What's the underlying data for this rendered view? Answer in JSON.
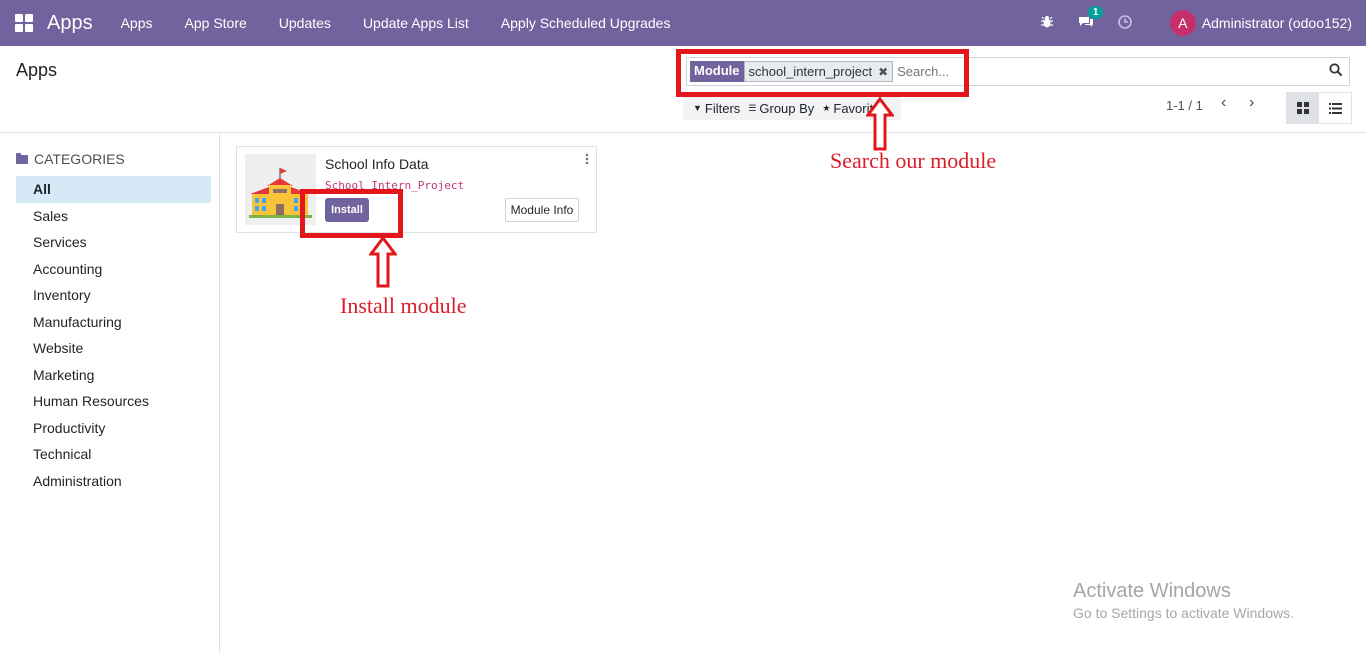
{
  "navbar": {
    "brand": "Apps",
    "menu": [
      "Apps",
      "App Store",
      "Updates",
      "Update Apps List",
      "Apply Scheduled Upgrades"
    ],
    "messages_badge": "1",
    "user_initial": "A",
    "user_name": "Administrator (odoo152)"
  },
  "control_panel": {
    "title": "Apps",
    "search": {
      "facet_label": "Module",
      "facet_value": "school_intern_project",
      "placeholder": "Search..."
    },
    "filters": {
      "filters": "Filters",
      "group_by": "Group By",
      "favorites": "Favorites"
    },
    "pager": "1-1 / 1"
  },
  "sidebar": {
    "header": "CATEGORIES",
    "items": [
      "All",
      "Sales",
      "Services",
      "Accounting",
      "Inventory",
      "Manufacturing",
      "Website",
      "Marketing",
      "Human Resources",
      "Productivity",
      "Technical",
      "Administration"
    ]
  },
  "card": {
    "title": "School Info Data",
    "technical_name": "School_Intern_Project",
    "install_label": "Install",
    "info_label": "Module Info"
  },
  "annotations": {
    "search": "Search our module",
    "install": "Install module",
    "color": "#e3161b"
  },
  "watermark": {
    "title": "Activate Windows",
    "subtitle": "Go to Settings to activate Windows."
  },
  "colors": {
    "brand": "#71639e",
    "active_category": "#d5eaf6",
    "technical_name": "#c0397a"
  }
}
